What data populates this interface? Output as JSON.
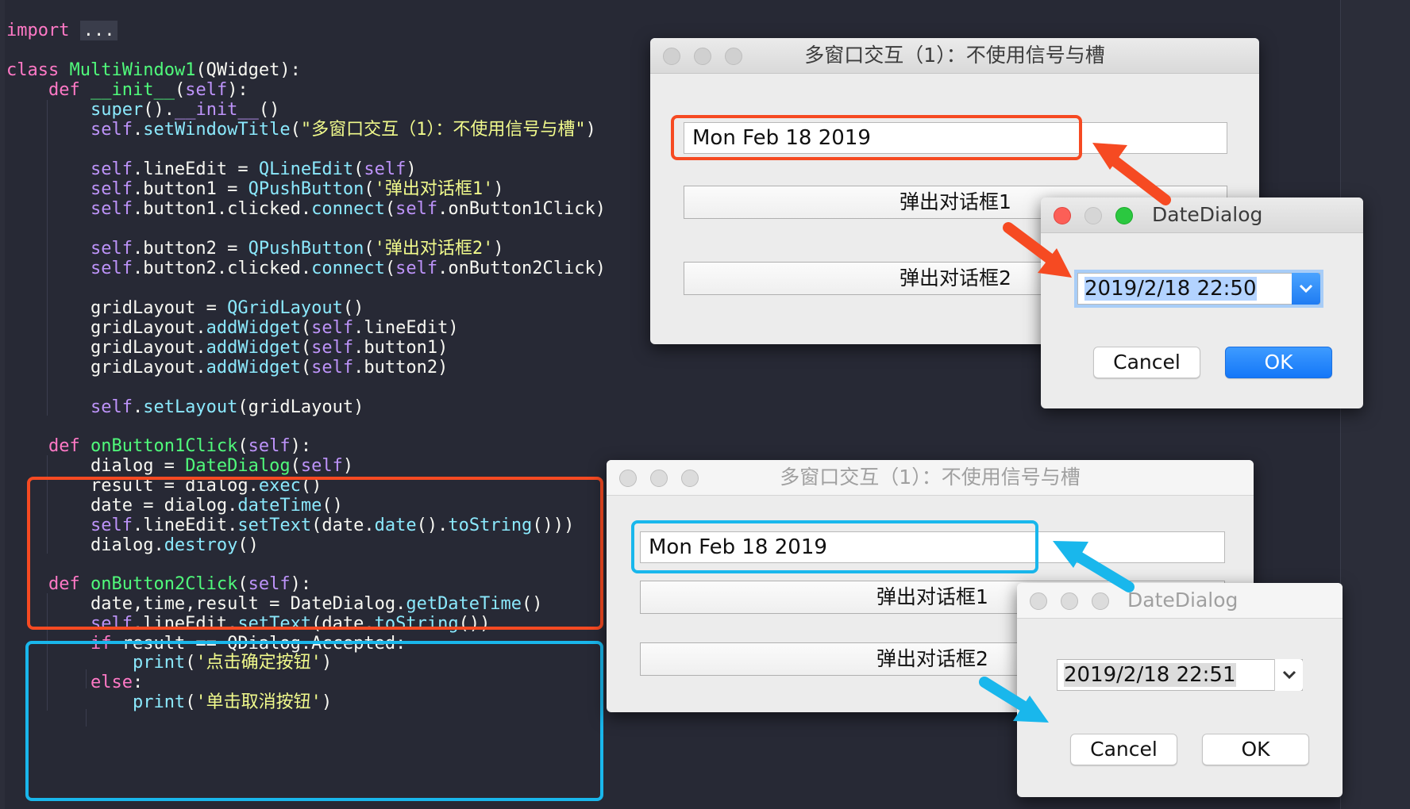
{
  "code": {
    "import_kw": "import",
    "import_fold": "...",
    "class_kw": "class",
    "class_name": "MultiWindow1",
    "class_base": "(QWidget):",
    "def_kw": "def",
    "init_name": "__init__",
    "self_kw": "self",
    "super_call": "super",
    "paren_open_close": "().",
    "init_call": "__init__",
    "empty_call": "()",
    "set_window_title": "setWindowTitle",
    "window_title_str": "\"多窗口交互（1）：不使用信号与槽\"",
    "line_edit_attr": ".lineEdit = ",
    "qlineedit": "QLineEdit",
    "button1_attr": ".button1 = ",
    "qpushbutton": "QPushButton",
    "button1_str": "'弹出对话框1'",
    "button1_clicked": ".button1.clicked.",
    "connect": "connect",
    "on_button1": ".onButton1Click)",
    "button2_attr": ".button2 = ",
    "button2_str": "'弹出对话框2'",
    "button2_clicked": ".button2.clicked.",
    "on_button2": ".onButton2Click)",
    "grid_assign": "gridLayout = ",
    "qgridlayout": "QGridLayout",
    "grid_var": "gridLayout.",
    "add_widget": "addWidget",
    "line_edit_arg": ".lineEdit)",
    "button1_arg": ".button1)",
    "button2_arg": ".button2)",
    "set_layout": "setLayout",
    "set_layout_arg": "(gridLayout)",
    "on_button1_click": "onButton1Click",
    "on_button2_click": "onButton2Click",
    "dialog_assign": "dialog = ",
    "date_dialog": "DateDialog",
    "result_assign": "result = dialog.",
    "exec": "exec",
    "date_assign": "date = dialog.",
    "date_time": "dateTime",
    "set_text": "setText",
    "line_edit_prefix": ".lineEdit.",
    "date_date": "(date.",
    "date_fn": "date",
    "to_string": "toString",
    "close_two": "())",
    "dialog_prefix": "dialog.",
    "destroy": "destroy",
    "tuple_assign": "date,time,result = DateDialog.",
    "get_date_time": "getDateTime",
    "if_kw": "if",
    "accepted_cond": " result == QDialog.Accepted:",
    "print_fn": "print",
    "print1_str": "'点击确定按钮'",
    "else_kw": "else",
    "print2_str": "'单击取消按钮'"
  },
  "window_top": {
    "title": "多窗口交互（1）：不使用信号与槽",
    "line_edit_value": "Mon Feb 18 2019",
    "button1_label": "弹出对话框1",
    "button2_label": "弹出对话框2"
  },
  "dialog_top": {
    "title": "DateDialog",
    "datetime_value": "2019/2/18 22:50",
    "cancel_label": "Cancel",
    "ok_label": "OK"
  },
  "window_bottom": {
    "title": "多窗口交互（1）：不使用信号与槽",
    "line_edit_value": "Mon Feb 18 2019",
    "button1_label": "弹出对话框1",
    "button2_label": "弹出对话框2"
  },
  "dialog_bottom": {
    "title": "DateDialog",
    "datetime_value": "2019/2/18 22:51",
    "cancel_label": "Cancel",
    "ok_label": "OK"
  },
  "colors": {
    "highlight_orange": "#f64a22",
    "highlight_blue": "#19b7ec",
    "editor_bg": "#272935",
    "ok_button": "#1477f8"
  }
}
